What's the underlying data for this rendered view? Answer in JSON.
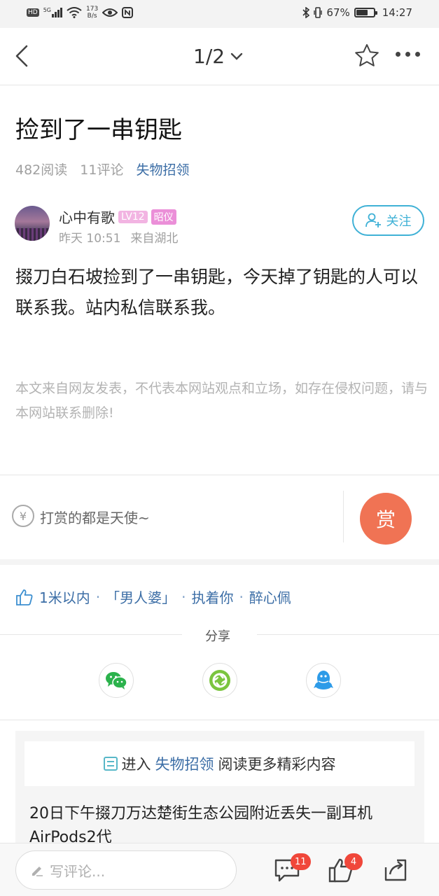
{
  "status_bar": {
    "hd": "HD",
    "network": "5G",
    "speed_value": "173",
    "speed_unit": "B/s",
    "battery_percent": "67%",
    "battery_level": 0.67,
    "time": "14:27"
  },
  "nav": {
    "pager": "1/2"
  },
  "post": {
    "title": "捡到了一串钥匙",
    "reads": "482阅读",
    "comments": "11评论",
    "channel": "失物招领",
    "author": {
      "name": "心中有歌",
      "level": "LV12",
      "rank_title": "昭仪",
      "time": "昨天 10:51",
      "location": "来自湖北"
    },
    "follow_label": "关注",
    "body": "掇刀白石坡捡到了一串钥匙，今天掉了钥匙的人可以联系我。站内私信联系我。",
    "disclaimer": "本文来自网友发表，不代表本网站观点和立场，如存在侵权问题，请与本网站联系删除!"
  },
  "tip": {
    "yen_symbol": "¥",
    "text": "打赏的都是天使~",
    "button_label": "赏"
  },
  "likers": {
    "names": [
      "1米以内",
      "「男人婆」",
      "执着你",
      "醉心佩"
    ],
    "separator": "·"
  },
  "share": {
    "label": "分享",
    "targets": [
      "wechat-icon",
      "moments-icon",
      "qq-icon"
    ]
  },
  "related": {
    "prefix": "进入",
    "channel": "失物招领",
    "suffix": "阅读更多精彩内容",
    "first_title": "20日下午掇刀万达楚街生态公园附近丢失一副耳机AirPods2代"
  },
  "bottom_bar": {
    "comment_placeholder": "写评论...",
    "comment_count": "11",
    "like_count": "4"
  },
  "colors": {
    "link_blue": "#3c6ea6",
    "follow_cyan": "#3fb1d6",
    "tip_orange": "#f07354",
    "badge_pink": "#eb8fd8",
    "notify_red": "#f0473a"
  }
}
